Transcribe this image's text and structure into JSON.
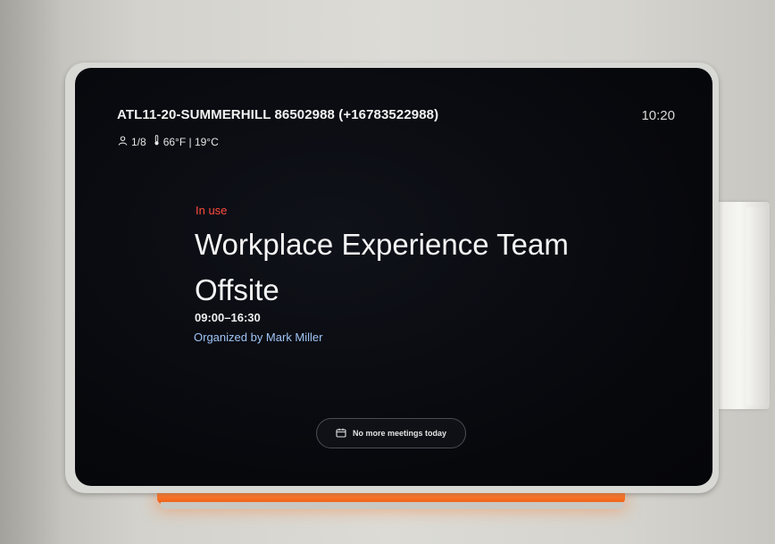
{
  "device": {
    "header": {
      "room_name": "ATL11-20-SUMMERHILL 86502988 (+16783522988)",
      "clock": "10:20"
    },
    "stats": {
      "occupancy": "1/8",
      "temperature": "66°F | 19°C",
      "person_icon": "person-icon",
      "thermometer_icon": "thermometer-icon"
    },
    "meeting": {
      "status": "In use",
      "status_color": "#ff4b3e",
      "title": "Workplace Experience Team Offsite",
      "time_range": "09:00–16:30",
      "organizer": "Organized by Mark Miller",
      "organizer_color": "#9fc4f5"
    },
    "next": {
      "label": "No more meetings today",
      "icon": "calendar-icon"
    },
    "status_light_color": "#ff7a2e"
  }
}
